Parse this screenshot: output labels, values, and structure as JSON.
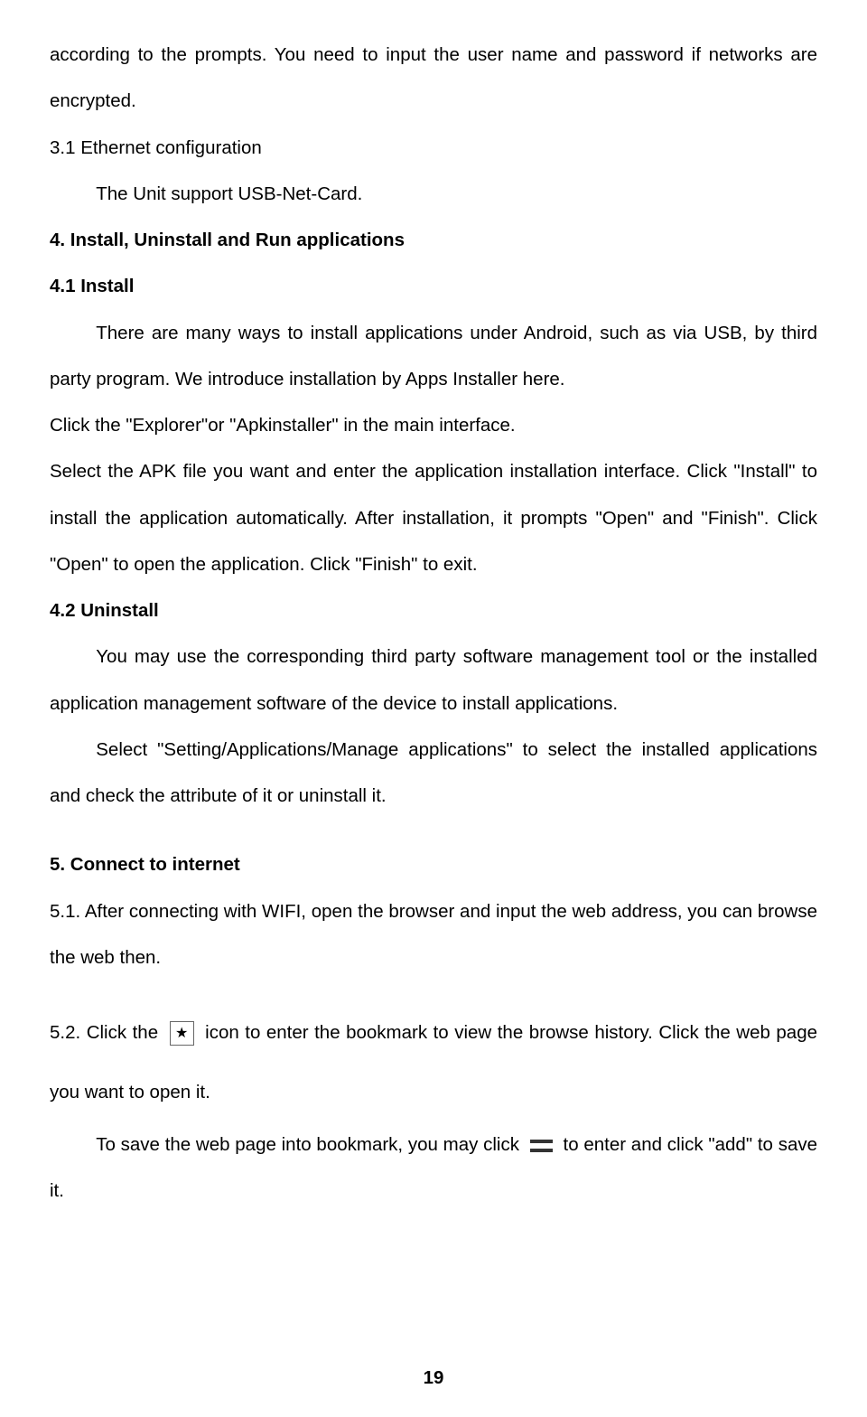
{
  "para1": "according to the prompts. You need to input the user name and password if networks are encrypted.",
  "section31": "3.1 Ethernet configuration",
  "section31_body": "The Unit support USB-Net-Card.",
  "section4": "4. Install, Uninstall and Run applications",
  "section41": "4.1 Install",
  "section41_body1": "There are many ways to install applications under Android, such as via USB, by third party program. We introduce installation by Apps Installer here.",
  "section41_body2": "Click the \"Explorer\"or \"Apkinstaller\" in the main interface.",
  "section41_body3": "Select the APK file you want and enter the application installation interface. Click \"Install\" to install the application automatically. After installation, it prompts \"Open\" and \"Finish\". Click \"Open\" to open the application. Click \"Finish\" to exit.",
  "section42": "4.2 Uninstall",
  "section42_body1": "You may use the corresponding third party software management tool or the installed application management software of the device to install applications.",
  "section42_body2": "Select \"Setting/Applications/Manage applications\" to select the installed applications and check the attribute of it or uninstall it.",
  "section5": "5. Connect to internet",
  "section51": "5.1.  After connecting with WIFI, open the browser and input the web address, you can browse the web then.",
  "section52_a": "5.2.   Click the",
  "section52_b": " icon to enter the bookmark to view the browse history. Click the web page you want to open it.",
  "section52_c": "To save the web page into bookmark, you may click",
  "section52_d": " to enter and click \"add\" to save it.",
  "star_glyph": "★",
  "page_number": "19"
}
